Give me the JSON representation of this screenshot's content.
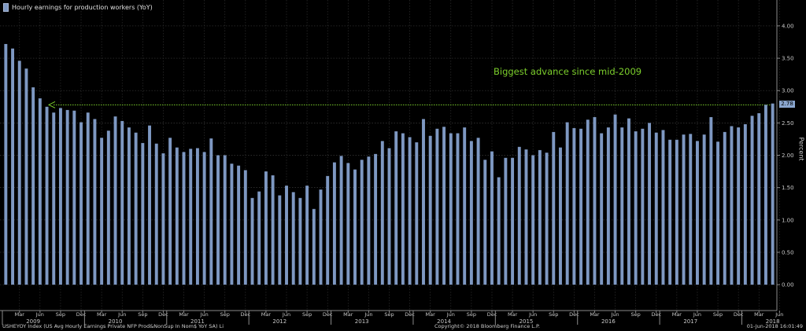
{
  "legend": {
    "label": "Hourly earnings for production workers (YoY)"
  },
  "annotation": {
    "text": "Biggest advance since mid-2009"
  },
  "last_value_badge": "2.78",
  "footer": {
    "left": "USHEYOY Index (US Avg Hourly Earnings Private NFP Prod&NonSup In Nom$ YoY SA) Li",
    "center": "Copyright© 2018 Bloomberg Finance L.P.",
    "right": "01-Jun-2018 16:01:49"
  },
  "colors": {
    "background": "#000000",
    "bar": "#7e98c2",
    "grid": "#3a3a3a",
    "annotation": "#7ccf2c",
    "text": "#c8c8c8"
  },
  "chart_data": {
    "type": "bar",
    "title": "",
    "ylabel": "Percent",
    "ylim": [
      -0.4,
      4.4
    ],
    "y_ticks": [
      "0.00",
      "0.50",
      "1.00",
      "1.50",
      "2.00",
      "2.50",
      "3.00",
      "3.50",
      "4.00"
    ],
    "y_axis_side": "right",
    "grid": true,
    "legend_placement": "top-left",
    "reference_line": {
      "y": 2.78,
      "style": "dotted",
      "color": "#7ccf2c",
      "label": "Biggest advance since mid-2009"
    },
    "month_tick_labels": [
      "Mar",
      "Jun",
      "Sep",
      "Dec",
      "Mar",
      "Jun",
      "Sep",
      "Dec",
      "Mar",
      "Jun",
      "Sep",
      "Dec",
      "Mar",
      "Jun",
      "Sep",
      "Dec",
      "Mar",
      "Jun",
      "Sep",
      "Dec",
      "Mar",
      "Jun",
      "Sep",
      "Dec",
      "Mar",
      "Jun",
      "Sep",
      "Dec",
      "Mar",
      "Jun",
      "Sep",
      "Dec",
      "Mar",
      "Jun",
      "Sep",
      "Dec",
      "Mar",
      "Jun"
    ],
    "year_labels": [
      "2009",
      "2010",
      "2011",
      "2012",
      "2013",
      "2014",
      "2015",
      "2016",
      "2017",
      "2018"
    ],
    "start": "2009-01",
    "end": "2018-05",
    "series": [
      {
        "values": [
          3.72,
          3.65,
          3.46,
          3.34,
          3.05,
          2.88,
          2.75,
          2.66,
          2.73,
          2.7,
          2.69,
          2.51,
          2.66,
          2.56,
          2.27,
          2.38,
          2.6,
          2.53,
          2.43,
          2.35,
          2.19,
          2.46,
          2.18,
          2.03,
          2.27,
          2.12,
          2.05,
          2.1,
          2.11,
          2.05,
          2.26,
          2.0,
          2.0,
          1.87,
          1.84,
          1.77,
          1.34,
          1.44,
          1.75,
          1.69,
          1.38,
          1.53,
          1.43,
          1.34,
          1.53,
          1.17,
          1.47,
          1.68,
          1.89,
          1.99,
          1.88,
          1.78,
          1.93,
          1.98,
          2.02,
          2.22,
          2.11,
          2.37,
          2.34,
          2.28,
          2.2,
          2.56,
          2.3,
          2.41,
          2.44,
          2.34,
          2.34,
          2.43,
          2.22,
          2.27,
          1.93,
          2.06,
          1.66,
          1.96,
          1.96,
          2.13,
          2.09,
          2.0,
          2.08,
          2.04,
          2.36,
          2.12,
          2.51,
          2.42,
          2.41,
          2.55,
          2.59,
          2.34,
          2.43,
          2.63,
          2.43,
          2.57,
          2.37,
          2.41,
          2.5,
          2.35,
          2.39,
          2.24,
          2.24,
          2.32,
          2.33,
          2.22,
          2.32,
          2.59,
          2.21,
          2.36,
          2.45,
          2.43,
          2.48,
          2.61,
          2.65,
          2.78,
          2.8
        ]
      }
    ]
  }
}
